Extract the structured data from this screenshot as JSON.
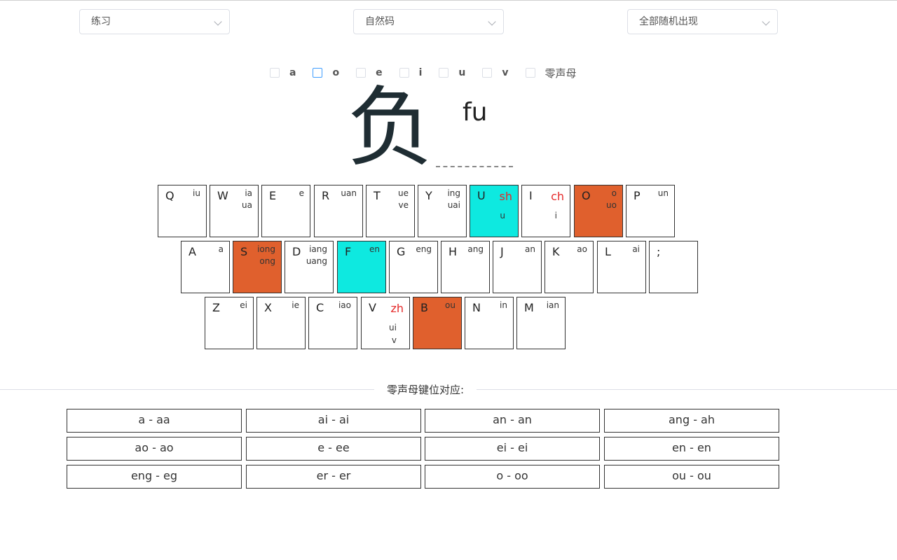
{
  "selects": {
    "mode": "练习",
    "scheme": "自然码",
    "order": "全部随机出现"
  },
  "filters": [
    {
      "label": "a"
    },
    {
      "label": "o"
    },
    {
      "label": "e"
    },
    {
      "label": "i"
    },
    {
      "label": "u"
    },
    {
      "label": "v"
    },
    {
      "label": "零声母"
    }
  ],
  "practice": {
    "character": "负",
    "pinyin": "fu"
  },
  "keyboard": {
    "row1": [
      {
        "letter": "Q",
        "tr1": "iu"
      },
      {
        "letter": "W",
        "tr1": "ia",
        "tr2": "ua"
      },
      {
        "letter": "E",
        "tr1": "e"
      },
      {
        "letter": "R",
        "tr1": "uan"
      },
      {
        "letter": "T",
        "tr1": "ue",
        "tr2": "ve"
      },
      {
        "letter": "Y",
        "tr1": "ing",
        "tr2": "uai"
      },
      {
        "letter": "U",
        "shengmu": "sh",
        "lower1": "u",
        "color": "cyan"
      },
      {
        "letter": "I",
        "shengmu": "ch",
        "lower1": "i"
      },
      {
        "letter": "O",
        "tr1": "o",
        "tr2": "uo",
        "color": "orange"
      },
      {
        "letter": "P",
        "tr1": "un"
      }
    ],
    "row2": [
      {
        "letter": "A",
        "tr1": "a"
      },
      {
        "letter": "S",
        "tr1": "iong",
        "tr2": "ong",
        "color": "orange"
      },
      {
        "letter": "D",
        "tr1": "iang",
        "tr2": "uang"
      },
      {
        "letter": "F",
        "tr1": "en",
        "color": "cyan"
      },
      {
        "letter": "G",
        "tr1": "eng"
      },
      {
        "letter": "H",
        "tr1": "ang"
      },
      {
        "letter": "J",
        "tr1": "an"
      },
      {
        "letter": "K",
        "tr1": "ao"
      },
      {
        "letter": "L",
        "tr1": "ai"
      },
      {
        "letter": ";"
      }
    ],
    "row3": [
      {
        "letter": "Z",
        "tr1": "ei"
      },
      {
        "letter": "X",
        "tr1": "ie"
      },
      {
        "letter": "C",
        "tr1": "iao"
      },
      {
        "letter": "V",
        "shengmu": "zh",
        "lower1": "ui",
        "lower2": "v"
      },
      {
        "letter": "B",
        "tr1": "ou",
        "color": "orange"
      },
      {
        "letter": "N",
        "tr1": "in"
      },
      {
        "letter": "M",
        "tr1": "ian"
      }
    ]
  },
  "zero_initial": {
    "title": "零声母键位对应:",
    "items": [
      "a - aa",
      "ai - ai",
      "an - an",
      "ang - ah",
      "ao - ao",
      "e - ee",
      "ei - ei",
      "en - en",
      "eng - eg",
      "er - er",
      "o - oo",
      "ou - ou"
    ]
  },
  "colors": {
    "orange": "#e0602d",
    "cyan": "#0ee9e0",
    "shengmu_red": "#e52a2a"
  }
}
